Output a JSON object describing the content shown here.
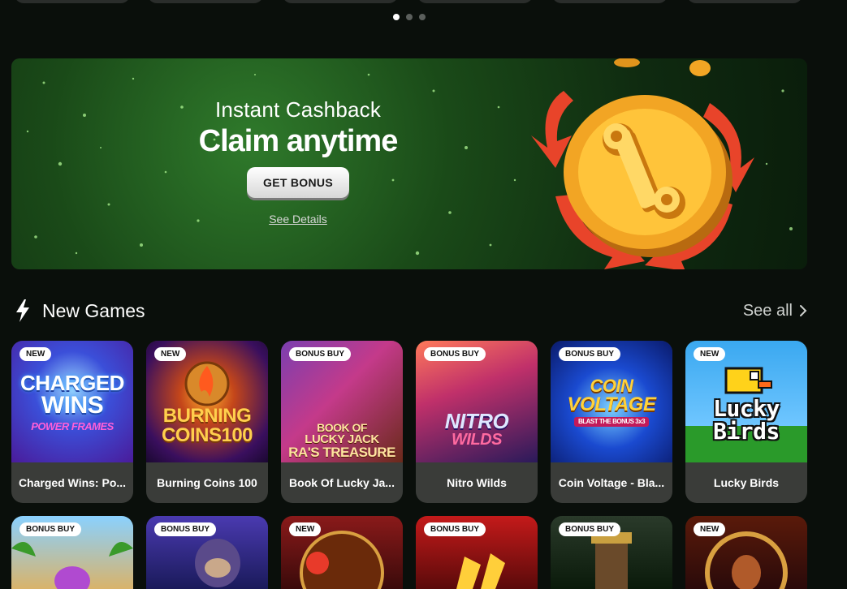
{
  "carousel": {
    "dots": 3,
    "active": 0
  },
  "banner": {
    "subtitle": "Instant Cashback",
    "title": "Claim anytime",
    "button_label": "GET BONUS",
    "details_link": "See Details"
  },
  "section": {
    "title": "New Games",
    "see_all_label": "See all"
  },
  "games_row1": [
    {
      "badge": "NEW",
      "name": "Charged Wins: Po...",
      "art": [
        "CHARGED",
        "WINS",
        "POWER FRAMES"
      ]
    },
    {
      "badge": "NEW",
      "name": "Burning Coins 100",
      "art": [
        "BURNING",
        "COINS100",
        ""
      ]
    },
    {
      "badge": "BONUS BUY",
      "name": "Book Of Lucky Ja...",
      "art": [
        "BOOK OF",
        "LUCKY JACK",
        "RA'S TREASURE"
      ]
    },
    {
      "badge": "BONUS BUY",
      "name": "Nitro Wilds",
      "art": [
        "NITRO",
        "WILDS",
        ""
      ]
    },
    {
      "badge": "BONUS BUY",
      "name": "Coin Voltage - Bla...",
      "art": [
        "COIN",
        "VOLTAGE",
        "BLAST THE BONUS 3x3"
      ]
    },
    {
      "badge": "NEW",
      "name": "Lucky Birds",
      "art": [
        "Lucky",
        "Birds",
        ""
      ]
    }
  ],
  "games_row2": [
    {
      "badge": "BONUS BUY"
    },
    {
      "badge": "BONUS BUY"
    },
    {
      "badge": "NEW"
    },
    {
      "badge": "BONUS BUY"
    },
    {
      "badge": "BONUS BUY"
    },
    {
      "badge": "NEW"
    }
  ],
  "colors": {
    "background": "#0a0f0b",
    "card": "#3a3c39",
    "accent_orange": "#f0a623",
    "accent_red": "#e8442a"
  }
}
